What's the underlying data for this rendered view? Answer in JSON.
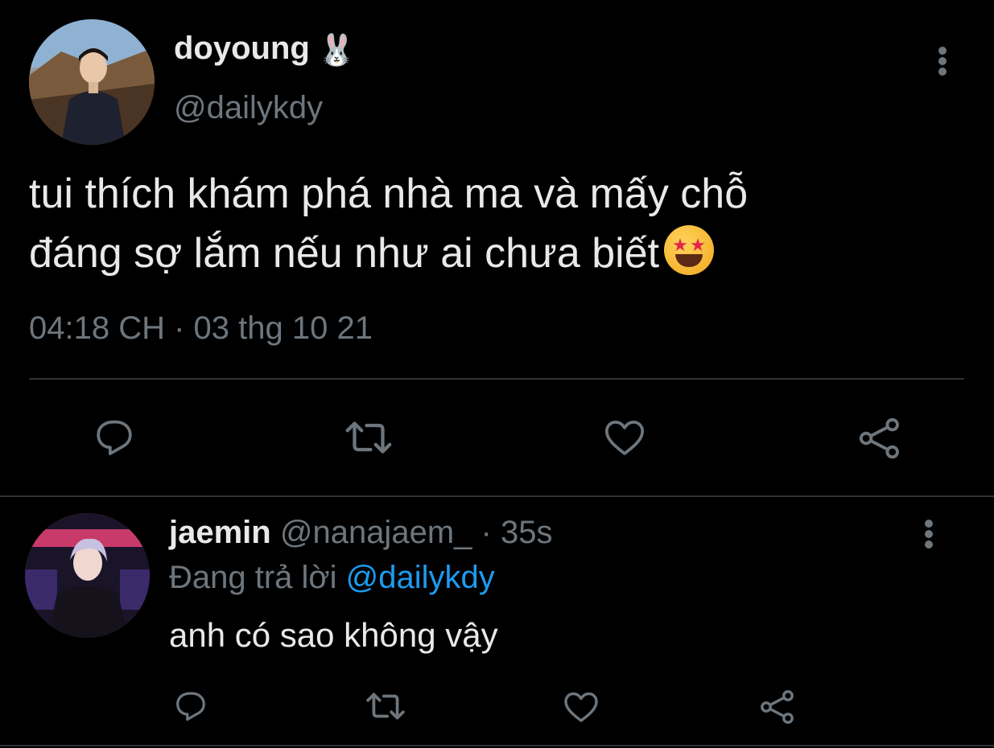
{
  "main_tweet": {
    "display_name": "doyoung",
    "name_emoji": "🐰",
    "handle": "@dailykdy",
    "text_line1": "tui thích khám phá nhà ma và mấy chỗ",
    "text_line2": "đáng sợ lắm nếu như ai chưa biết",
    "text_emoji": "star-struck",
    "timestamp": "04:18 CH · 03 thg 10 21",
    "actions": [
      "reply-icon",
      "retweet-icon",
      "like-icon",
      "share-icon"
    ]
  },
  "reply": {
    "display_name": "jaemin",
    "handle": "@nanajaem_",
    "separator": "·",
    "time": "35s",
    "replying_prefix": "Đang trả lời",
    "replying_to": "@dailykdy",
    "text": "anh có sao không vậy",
    "actions": [
      "reply-icon",
      "retweet-icon",
      "like-icon",
      "share-icon"
    ]
  },
  "colors": {
    "background": "#000000",
    "primary_text": "#e7e9ea",
    "secondary_text": "#6e767d",
    "link": "#1d9bf0",
    "divider": "#2f3336"
  }
}
